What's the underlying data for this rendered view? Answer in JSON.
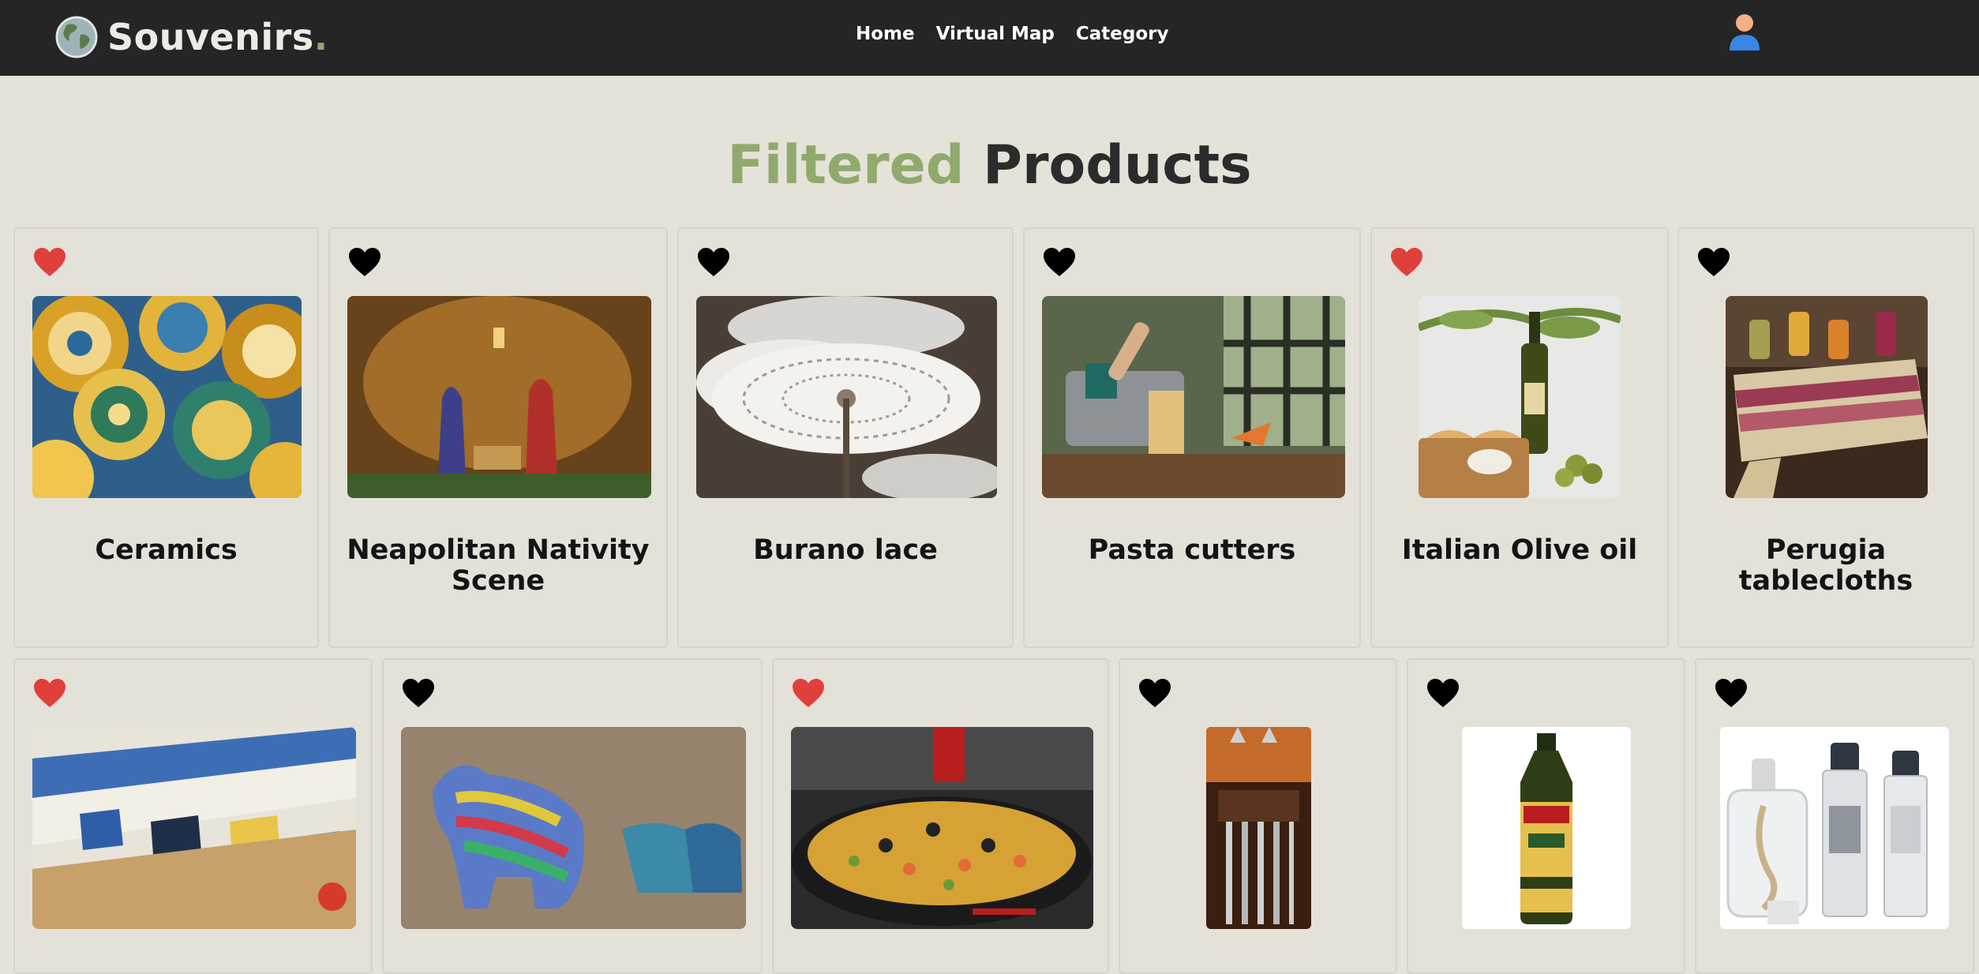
{
  "brand": {
    "name": "Souvenirs",
    "dot": "."
  },
  "nav": {
    "links": [
      "Home",
      "Virtual Map",
      "Category"
    ]
  },
  "heading": {
    "first": "Filtered",
    "second": "Products"
  },
  "colors": {
    "accent_green": "#8faa6c",
    "heart_liked": "#e0403c",
    "heart_unliked": "#000000",
    "navbar": "#252525",
    "page": "#e5e2d9"
  },
  "products": [
    {
      "name": "Ceramics",
      "liked": true
    },
    {
      "name": "Neapolitan Nativity Scene",
      "liked": false
    },
    {
      "name": "Burano lace",
      "liked": false
    },
    {
      "name": "Pasta cutters",
      "liked": false
    },
    {
      "name": "Italian Olive oil",
      "liked": true
    },
    {
      "name": "Perugia tablecloths",
      "liked": false
    },
    {
      "name": "",
      "liked": true
    },
    {
      "name": "",
      "liked": false
    },
    {
      "name": "",
      "liked": true
    },
    {
      "name": "",
      "liked": false
    },
    {
      "name": "",
      "liked": false
    },
    {
      "name": "",
      "liked": false
    }
  ]
}
